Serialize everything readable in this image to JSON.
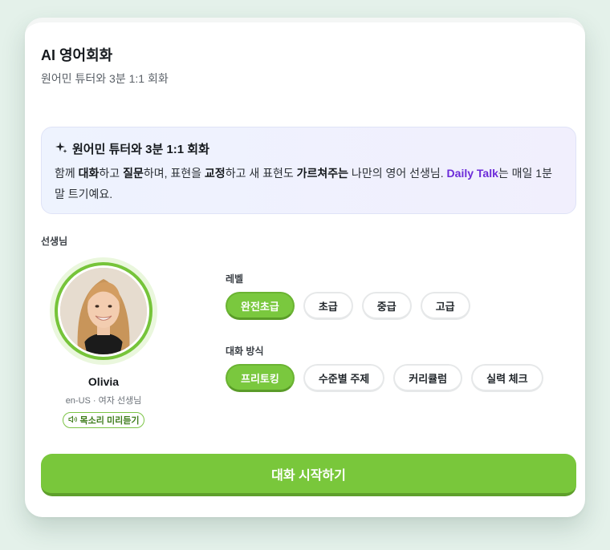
{
  "header": {
    "title": "AI 영어회화",
    "subtitle": "원어민 튜터와 3분 1:1 회화"
  },
  "intro": {
    "title": "원어민 튜터와 3분 1:1 회화",
    "sparkle_icon": "sparkle-icon",
    "body": {
      "t1": "함께 ",
      "b1": "대화",
      "t2": "하고 ",
      "b2": "질문",
      "t3": "하며, 표현을 ",
      "b3": "교정",
      "t4": "하고 새 표현도 ",
      "b4": "가르쳐주는",
      "t5": " 나만의 영어 선생님. ",
      "brand": "Daily Talk",
      "t6": "는 매일 1분 말 트기예요."
    }
  },
  "tutor": {
    "section_label": "선생님",
    "name": "Olivia",
    "meta": "en-US · 여자 선생님",
    "voice_icon": "speaker-icon",
    "voice_label": "목소리 미리듣기"
  },
  "level": {
    "label": "레벨",
    "options": [
      "완전초급",
      "초급",
      "중급",
      "고급"
    ],
    "selected": "완전초급"
  },
  "mode": {
    "label": "대화 방식",
    "options": [
      "프리토킹",
      "수준별 주제",
      "커리큘럼",
      "실력 체크"
    ],
    "selected": "프리토킹"
  },
  "actions": {
    "start_label": "대화 시작하기"
  },
  "colors": {
    "accent": "#79c73b",
    "brand_purple": "#6c2bd9",
    "background": "#e4f1ea"
  }
}
